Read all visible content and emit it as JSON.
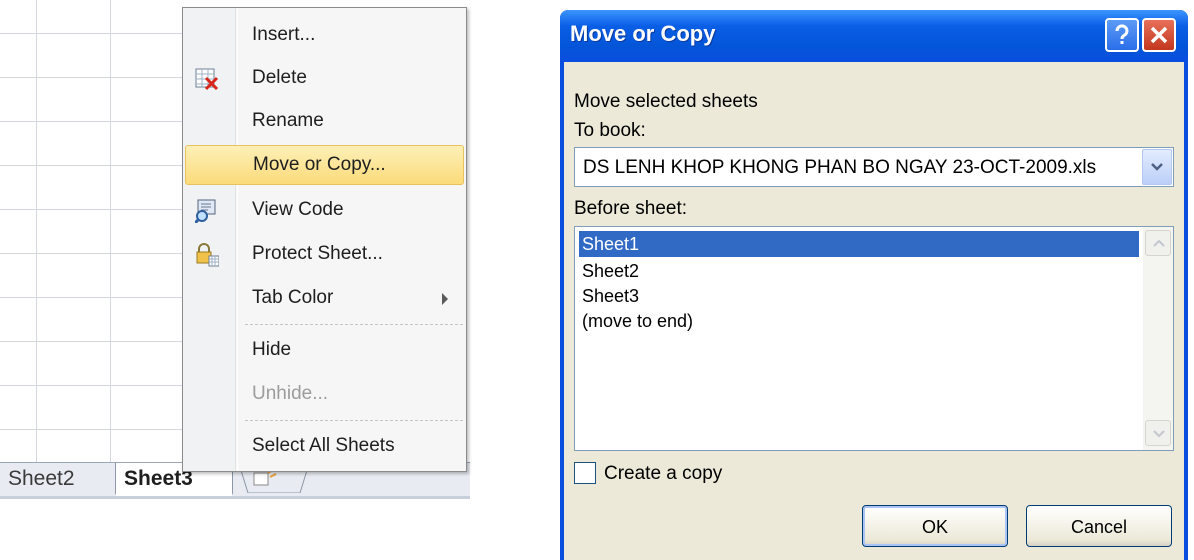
{
  "excel": {
    "tabs": [
      {
        "label": "Sheet2"
      },
      {
        "label": "Sheet3"
      }
    ],
    "context_menu": {
      "items": [
        {
          "label": "Insert...",
          "icon": "",
          "enabled": true
        },
        {
          "label": "Delete",
          "icon": "delete-sheet-icon",
          "enabled": true
        },
        {
          "label": "Rename",
          "icon": "",
          "enabled": true
        },
        {
          "label": "Move or Copy...",
          "icon": "",
          "enabled": true,
          "highlighted": true
        },
        {
          "label": "View Code",
          "icon": "view-code-icon",
          "enabled": true
        },
        {
          "label": "Protect Sheet...",
          "icon": "protect-sheet-icon",
          "enabled": true
        },
        {
          "label": "Tab Color",
          "icon": "",
          "enabled": true,
          "submenu": true
        },
        {
          "label": "Hide",
          "icon": "",
          "enabled": true
        },
        {
          "label": "Unhide...",
          "icon": "",
          "enabled": false
        },
        {
          "label": "Select All Sheets",
          "icon": "",
          "enabled": true
        }
      ]
    }
  },
  "dialog": {
    "title": "Move or Copy",
    "intro": "Move selected sheets",
    "to_book_label": "To book:",
    "to_book_value": "DS LENH KHOP KHONG PHAN BO NGAY 23-OCT-2009.xls",
    "before_sheet_label": "Before sheet:",
    "sheets": [
      "Sheet1",
      "Sheet2",
      "Sheet3",
      "(move to end)"
    ],
    "selected_sheet": "Sheet1",
    "create_copy_label": "Create a copy",
    "create_copy_checked": false,
    "ok_label": "OK",
    "cancel_label": "Cancel"
  },
  "colors": {
    "titlebar": "#0a5fe6",
    "dialog_face": "#ece9d8",
    "menu_highlight": "#fbdb7a",
    "list_selection": "#316ac5"
  }
}
